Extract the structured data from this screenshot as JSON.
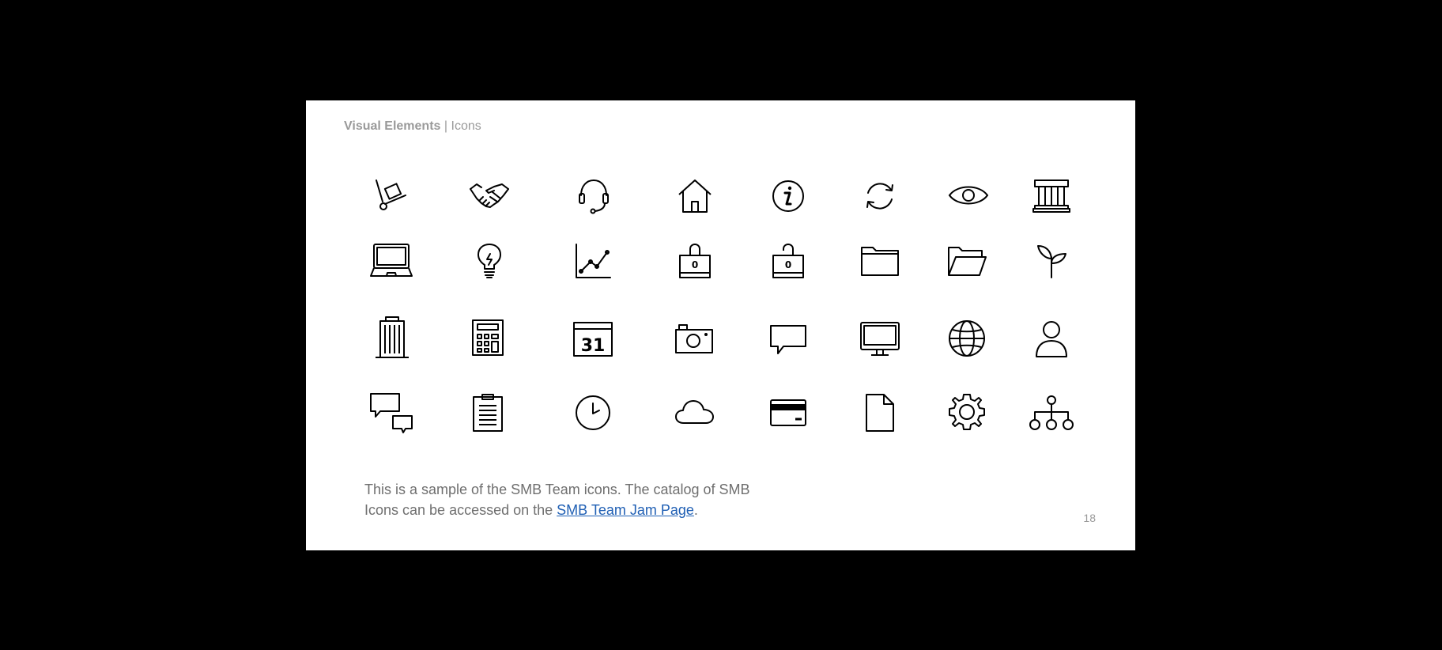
{
  "header": {
    "section": "Visual Elements",
    "separator": "|",
    "subtitle": "Icons"
  },
  "icons": [
    "hand-truck-icon",
    "handshake-icon",
    "headset-icon",
    "house-icon",
    "info-icon",
    "refresh-icon",
    "eye-icon",
    "bank-icon",
    "laptop-icon",
    "lightbulb-icon",
    "line-chart-icon",
    "lock-closed-icon",
    "lock-open-icon",
    "folder-icon",
    "folder-open-icon",
    "plant-icon",
    "office-building-icon",
    "calculator-icon",
    "calendar-icon",
    "camera-icon",
    "chat-bubble-icon",
    "monitor-icon",
    "globe-icon",
    "user-icon",
    "chat-conversation-icon",
    "clipboard-icon",
    "clock-icon",
    "cloud-icon",
    "credit-card-icon",
    "document-icon",
    "gear-icon",
    "org-chart-icon"
  ],
  "calendar_day": "31",
  "lock_digit": "0",
  "caption": {
    "text_before": "This is a sample of the SMB Team icons. The catalog of SMB Icons can be accessed on the ",
    "link_text": "SMB Team Jam Page",
    "text_after": "."
  },
  "page_number": "18"
}
